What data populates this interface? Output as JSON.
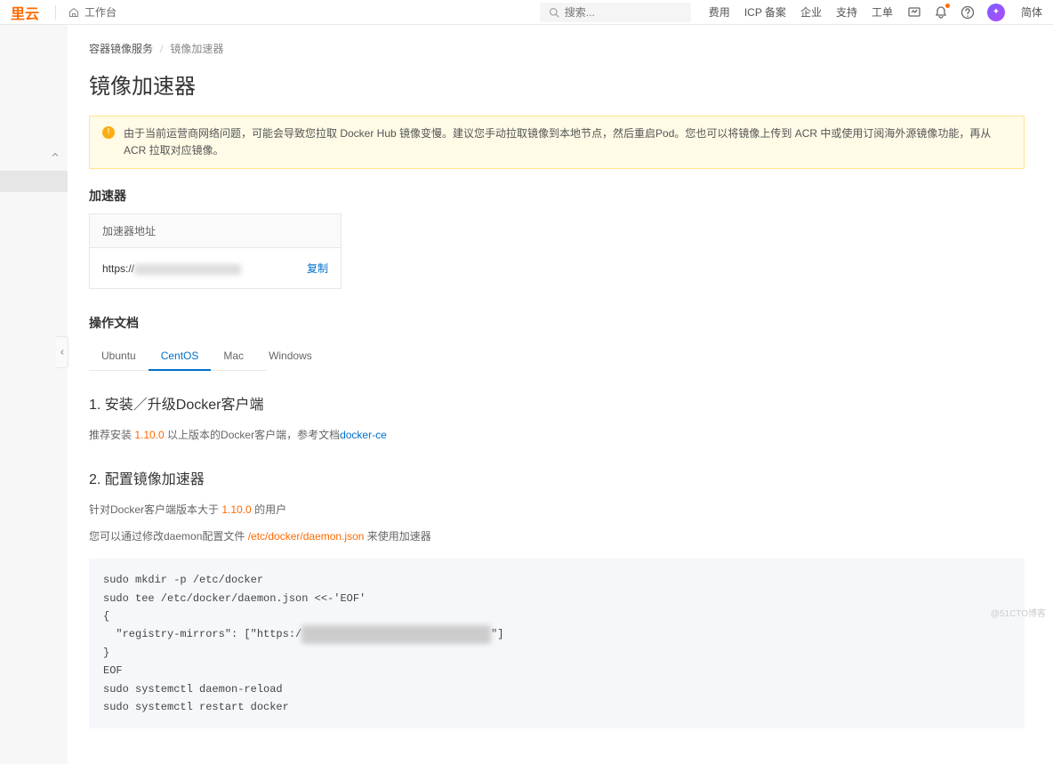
{
  "header": {
    "logo": "里云",
    "workspace": "工作台",
    "search_placeholder": "搜索...",
    "links": {
      "fee": "费用",
      "icp": "ICP 备案",
      "enterprise": "企业",
      "support": "支持",
      "ticket": "工单"
    },
    "lang": "简体"
  },
  "breadcrumb": {
    "parent": "容器镜像服务",
    "current": "镜像加速器"
  },
  "page_title": "镜像加速器",
  "alert": {
    "text": "由于当前运营商网络问题，可能会导致您拉取 Docker Hub 镜像变慢。建议您手动拉取镜像到本地节点，然后重启Pod。您也可以将镜像上传到 ACR 中或使用订阅海外源镜像功能，再从 ACR 拉取对应镜像。"
  },
  "accelerator": {
    "section_label": "加速器",
    "header": "加速器地址",
    "url_prefix": "https://",
    "copy": "复制"
  },
  "docs": {
    "section_label": "操作文档",
    "tabs": {
      "ubuntu": "Ubuntu",
      "centos": "CentOS",
      "mac": "Mac",
      "windows": "Windows"
    },
    "step1": {
      "title": "1. 安装／升级Docker客户端",
      "prefix": "推荐安装 ",
      "version": "1.10.0",
      "mid": " 以上版本的Docker客户端，参考文档",
      "link": "docker-ce"
    },
    "step2": {
      "title": "2. 配置镜像加速器",
      "line1_prefix": "针对Docker客户端版本大于 ",
      "line1_version": "1.10.0",
      "line1_suffix": " 的用户",
      "line2_prefix": "您可以通过修改daemon配置文件 ",
      "line2_path": "/etc/docker/daemon.json",
      "line2_suffix": " 来使用加速器"
    },
    "code": {
      "l1": "sudo mkdir -p /etc/docker",
      "l2": "sudo tee /etc/docker/daemon.json <<-'EOF'",
      "l3": "{",
      "l4a": "  \"registry-mirrors\": [\"https:/",
      "l4b": "\"]",
      "l5": "}",
      "l6": "EOF",
      "l7": "sudo systemctl daemon-reload",
      "l8": "sudo systemctl restart docker"
    }
  },
  "watermark": "@51CTO博客"
}
